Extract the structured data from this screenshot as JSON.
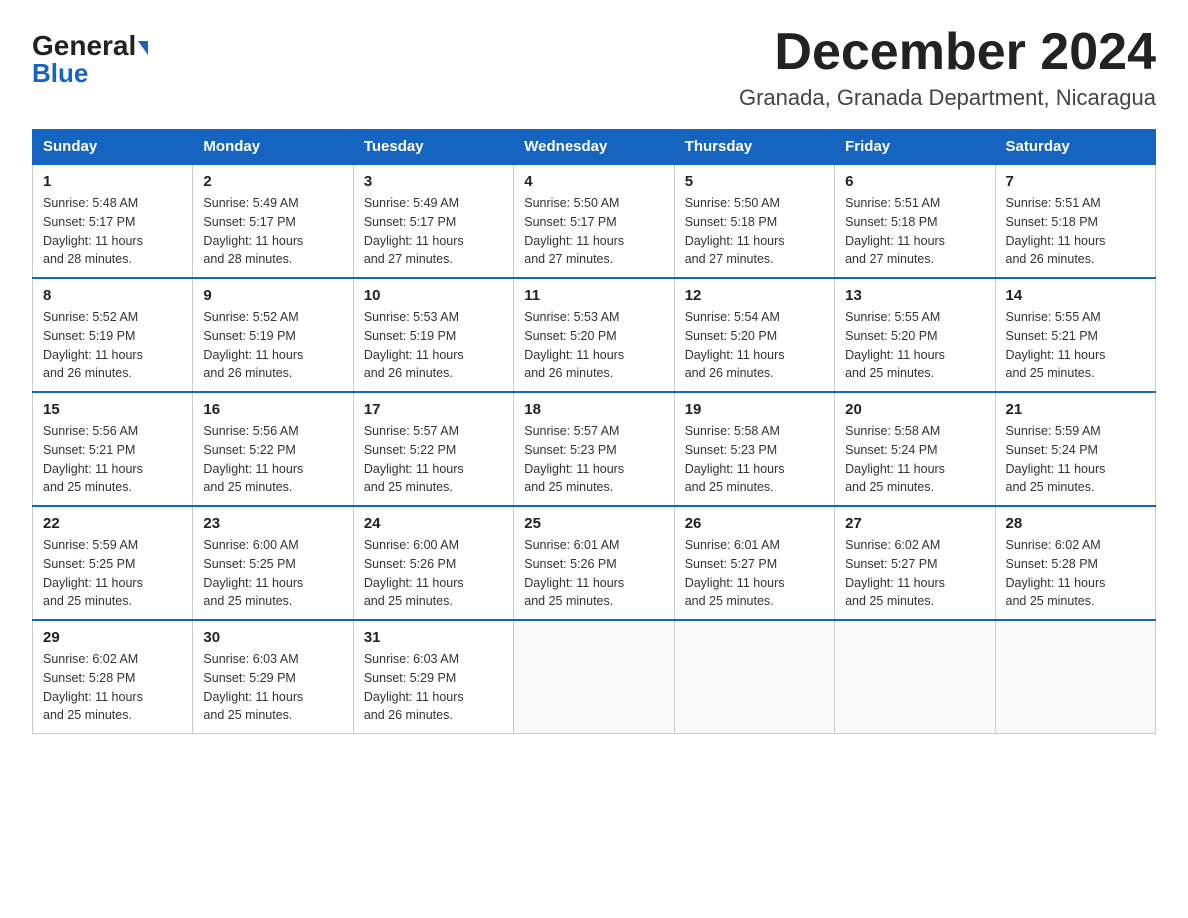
{
  "logo": {
    "general": "General",
    "triangle": "▶",
    "blue": "Blue"
  },
  "title": {
    "month": "December 2024",
    "location": "Granada, Granada Department, Nicaragua"
  },
  "weekdays": [
    "Sunday",
    "Monday",
    "Tuesday",
    "Wednesday",
    "Thursday",
    "Friday",
    "Saturday"
  ],
  "weeks": [
    [
      {
        "day": "1",
        "sunrise": "5:48 AM",
        "sunset": "5:17 PM",
        "daylight": "11 hours and 28 minutes."
      },
      {
        "day": "2",
        "sunrise": "5:49 AM",
        "sunset": "5:17 PM",
        "daylight": "11 hours and 28 minutes."
      },
      {
        "day": "3",
        "sunrise": "5:49 AM",
        "sunset": "5:17 PM",
        "daylight": "11 hours and 27 minutes."
      },
      {
        "day": "4",
        "sunrise": "5:50 AM",
        "sunset": "5:17 PM",
        "daylight": "11 hours and 27 minutes."
      },
      {
        "day": "5",
        "sunrise": "5:50 AM",
        "sunset": "5:18 PM",
        "daylight": "11 hours and 27 minutes."
      },
      {
        "day": "6",
        "sunrise": "5:51 AM",
        "sunset": "5:18 PM",
        "daylight": "11 hours and 27 minutes."
      },
      {
        "day": "7",
        "sunrise": "5:51 AM",
        "sunset": "5:18 PM",
        "daylight": "11 hours and 26 minutes."
      }
    ],
    [
      {
        "day": "8",
        "sunrise": "5:52 AM",
        "sunset": "5:19 PM",
        "daylight": "11 hours and 26 minutes."
      },
      {
        "day": "9",
        "sunrise": "5:52 AM",
        "sunset": "5:19 PM",
        "daylight": "11 hours and 26 minutes."
      },
      {
        "day": "10",
        "sunrise": "5:53 AM",
        "sunset": "5:19 PM",
        "daylight": "11 hours and 26 minutes."
      },
      {
        "day": "11",
        "sunrise": "5:53 AM",
        "sunset": "5:20 PM",
        "daylight": "11 hours and 26 minutes."
      },
      {
        "day": "12",
        "sunrise": "5:54 AM",
        "sunset": "5:20 PM",
        "daylight": "11 hours and 26 minutes."
      },
      {
        "day": "13",
        "sunrise": "5:55 AM",
        "sunset": "5:20 PM",
        "daylight": "11 hours and 25 minutes."
      },
      {
        "day": "14",
        "sunrise": "5:55 AM",
        "sunset": "5:21 PM",
        "daylight": "11 hours and 25 minutes."
      }
    ],
    [
      {
        "day": "15",
        "sunrise": "5:56 AM",
        "sunset": "5:21 PM",
        "daylight": "11 hours and 25 minutes."
      },
      {
        "day": "16",
        "sunrise": "5:56 AM",
        "sunset": "5:22 PM",
        "daylight": "11 hours and 25 minutes."
      },
      {
        "day": "17",
        "sunrise": "5:57 AM",
        "sunset": "5:22 PM",
        "daylight": "11 hours and 25 minutes."
      },
      {
        "day": "18",
        "sunrise": "5:57 AM",
        "sunset": "5:23 PM",
        "daylight": "11 hours and 25 minutes."
      },
      {
        "day": "19",
        "sunrise": "5:58 AM",
        "sunset": "5:23 PM",
        "daylight": "11 hours and 25 minutes."
      },
      {
        "day": "20",
        "sunrise": "5:58 AM",
        "sunset": "5:24 PM",
        "daylight": "11 hours and 25 minutes."
      },
      {
        "day": "21",
        "sunrise": "5:59 AM",
        "sunset": "5:24 PM",
        "daylight": "11 hours and 25 minutes."
      }
    ],
    [
      {
        "day": "22",
        "sunrise": "5:59 AM",
        "sunset": "5:25 PM",
        "daylight": "11 hours and 25 minutes."
      },
      {
        "day": "23",
        "sunrise": "6:00 AM",
        "sunset": "5:25 PM",
        "daylight": "11 hours and 25 minutes."
      },
      {
        "day": "24",
        "sunrise": "6:00 AM",
        "sunset": "5:26 PM",
        "daylight": "11 hours and 25 minutes."
      },
      {
        "day": "25",
        "sunrise": "6:01 AM",
        "sunset": "5:26 PM",
        "daylight": "11 hours and 25 minutes."
      },
      {
        "day": "26",
        "sunrise": "6:01 AM",
        "sunset": "5:27 PM",
        "daylight": "11 hours and 25 minutes."
      },
      {
        "day": "27",
        "sunrise": "6:02 AM",
        "sunset": "5:27 PM",
        "daylight": "11 hours and 25 minutes."
      },
      {
        "day": "28",
        "sunrise": "6:02 AM",
        "sunset": "5:28 PM",
        "daylight": "11 hours and 25 minutes."
      }
    ],
    [
      {
        "day": "29",
        "sunrise": "6:02 AM",
        "sunset": "5:28 PM",
        "daylight": "11 hours and 25 minutes."
      },
      {
        "day": "30",
        "sunrise": "6:03 AM",
        "sunset": "5:29 PM",
        "daylight": "11 hours and 25 minutes."
      },
      {
        "day": "31",
        "sunrise": "6:03 AM",
        "sunset": "5:29 PM",
        "daylight": "11 hours and 26 minutes."
      },
      null,
      null,
      null,
      null
    ]
  ],
  "labels": {
    "sunrise": "Sunrise:",
    "sunset": "Sunset:",
    "daylight": "Daylight:"
  }
}
